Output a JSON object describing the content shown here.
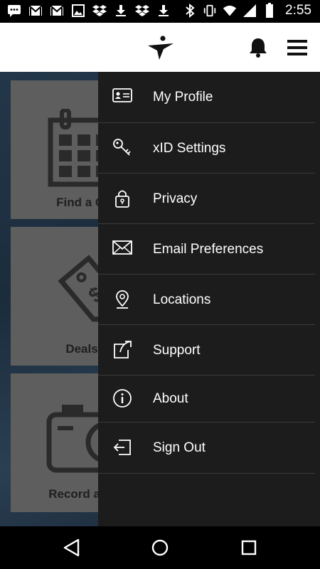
{
  "status_bar": {
    "time": "2:55",
    "left_icons": [
      "sms-icon",
      "gmail-icon",
      "gmail-icon",
      "image-icon",
      "dropbox-icon",
      "download-icon",
      "dropbox-icon",
      "download-icon"
    ],
    "right_icons": [
      "bluetooth-icon",
      "vibrate-icon",
      "wifi-icon",
      "signal-icon",
      "battery-icon"
    ]
  },
  "header": {
    "logo": "brand-logo",
    "notification_icon": "bell-icon",
    "menu_icon": "hamburger-icon"
  },
  "background_tiles": [
    {
      "label": "Find a Cl",
      "icon": "calendar-icon"
    },
    {
      "label": "Deals",
      "icon": "price-tag-icon"
    },
    {
      "label": "Record a W",
      "icon": "camera-icon"
    }
  ],
  "drawer": {
    "items": [
      {
        "label": "My Profile",
        "icon": "id-card-icon"
      },
      {
        "label": "xID Settings",
        "icon": "key-icon"
      },
      {
        "label": "Privacy",
        "icon": "lock-icon"
      },
      {
        "label": "Email Preferences",
        "icon": "envelope-icon"
      },
      {
        "label": "Locations",
        "icon": "map-pin-icon"
      },
      {
        "label": "Support",
        "icon": "external-link-icon"
      },
      {
        "label": "About",
        "icon": "info-icon"
      },
      {
        "label": "Sign Out",
        "icon": "sign-out-icon"
      }
    ]
  },
  "nav_bar": {
    "buttons": [
      "back-icon",
      "home-icon",
      "recents-icon"
    ]
  },
  "colors": {
    "drawer_bg": "#1c1c1c",
    "header_bg": "#ffffff",
    "tile_bg": "#5e5e5e"
  }
}
